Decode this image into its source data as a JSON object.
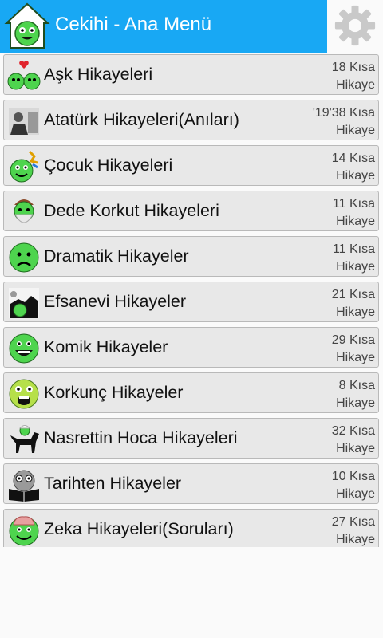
{
  "header": {
    "title": "Cekihi - Ana Menü",
    "colors": {
      "bar": "#18a8f4",
      "logo_face": "#4ed44e"
    }
  },
  "categories": [
    {
      "label": "Aşk Hikayeleri",
      "count": "18 Kısa",
      "unit": "Hikaye",
      "icon": "love-smiley-icon"
    },
    {
      "label": "Atatürk Hikayeleri(Anıları)",
      "count": "'19'38 Kısa",
      "unit": "Hikaye",
      "icon": "ataturk-portrait-icon"
    },
    {
      "label": "Çocuk Hikayeleri",
      "count": "14 Kısa",
      "unit": "Hikaye",
      "icon": "child-smiley-icon"
    },
    {
      "label": "Dede Korkut Hikayeleri",
      "count": "11 Kısa",
      "unit": "Hikaye",
      "icon": "dede-korkut-icon"
    },
    {
      "label": "Dramatik Hikayeler",
      "count": "11 Kısa",
      "unit": "Hikaye",
      "icon": "sad-smiley-icon"
    },
    {
      "label": "Efsanevi Hikayeler",
      "count": "21 Kısa",
      "unit": "Hikaye",
      "icon": "legend-icon"
    },
    {
      "label": "Komik Hikayeler",
      "count": "29 Kısa",
      "unit": "Hikaye",
      "icon": "laughing-smiley-icon"
    },
    {
      "label": "Korkunç Hikayeler",
      "count": "8 Kısa",
      "unit": "Hikaye",
      "icon": "scared-smiley-icon"
    },
    {
      "label": "Nasrettin Hoca Hikayeleri",
      "count": "32 Kısa",
      "unit": "Hikaye",
      "icon": "donkey-icon"
    },
    {
      "label": "Tarihten Hikayeler",
      "count": "10 Kısa",
      "unit": "Hikaye",
      "icon": "reading-smiley-icon"
    },
    {
      "label": "Zeka Hikayeleri(Soruları)",
      "count": "27 Kısa",
      "unit": "Hikaye",
      "icon": "brain-smiley-icon"
    }
  ]
}
